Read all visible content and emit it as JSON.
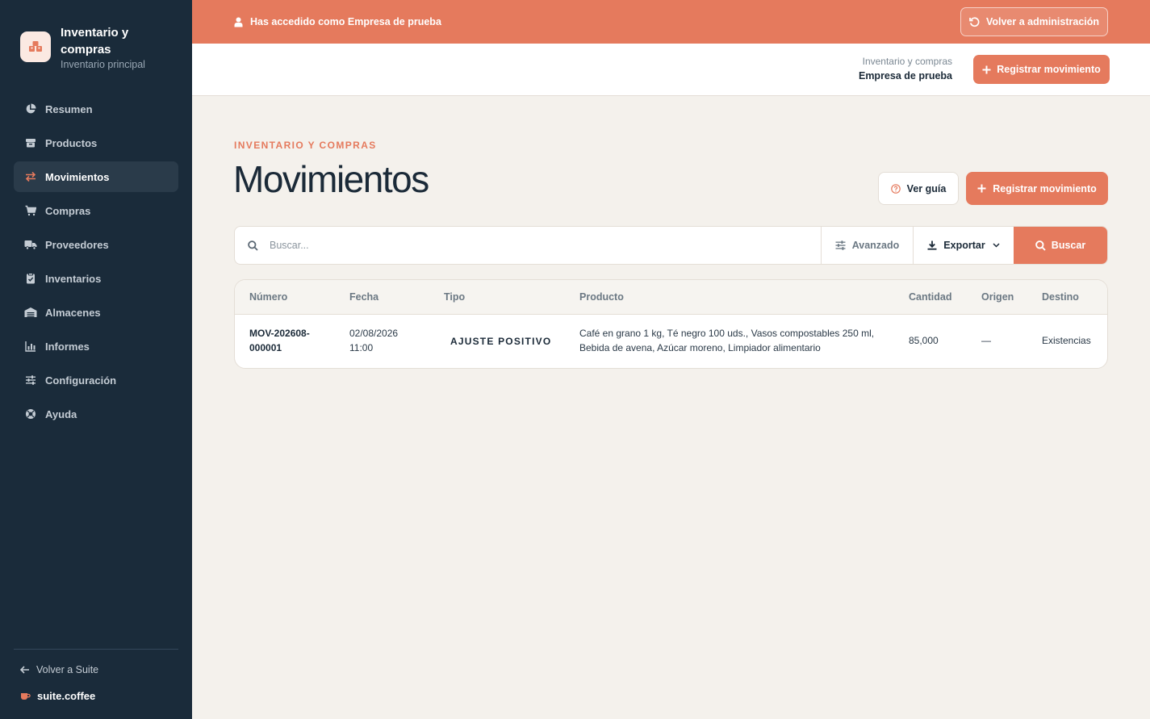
{
  "sidebar": {
    "app_title": "Inventario y compras",
    "app_subtitle": "Inventario principal",
    "items": [
      {
        "label": "Resumen",
        "icon": "pie-chart-icon"
      },
      {
        "label": "Productos",
        "icon": "box-icon"
      },
      {
        "label": "Movimientos",
        "icon": "arrows-swap-icon",
        "active": true
      },
      {
        "label": "Compras",
        "icon": "cart-icon"
      },
      {
        "label": "Proveedores",
        "icon": "truck-icon"
      },
      {
        "label": "Inventarios",
        "icon": "clipboard-check-icon"
      },
      {
        "label": "Almacenes",
        "icon": "warehouse-icon"
      },
      {
        "label": "Informes",
        "icon": "bar-chart-icon"
      },
      {
        "label": "Configuración",
        "icon": "sliders-icon"
      },
      {
        "label": "Ayuda",
        "icon": "lifebuoy-icon"
      }
    ],
    "back_label": "Volver a Suite",
    "suite_brand": "suite.coffee"
  },
  "banner": {
    "text": "Has accedido como Empresa de prueba",
    "button_label": "Volver a administración"
  },
  "header": {
    "crumb_module": "Inventario y compras",
    "crumb_company": "Empresa de prueba",
    "button_label": "Registrar movimiento"
  },
  "main": {
    "eyebrow": "INVENTARIO Y COMPRAS",
    "title": "Movimientos",
    "guide_label": "Ver guía",
    "primary_label": "Registrar movimiento"
  },
  "search": {
    "placeholder": "Buscar...",
    "value": "",
    "advanced_label": "Avanzado",
    "export_label": "Exportar",
    "submit_label": "Buscar"
  },
  "table": {
    "columns": [
      "Número",
      "Fecha",
      "Tipo",
      "Producto",
      "Cantidad",
      "Origen",
      "Destino"
    ],
    "rows": [
      {
        "numero_l1": "MOV-202608-",
        "numero_l2": "000001",
        "fecha_l1": "02/08/2026",
        "fecha_l2": "11:00",
        "tipo": "AJUSTE POSITIVO",
        "producto_l1": "Café en grano 1 kg, Té negro 100 uds., Vasos compostables 250 ml,",
        "producto_l2": "Bebida de avena, Azúcar moreno, Limpiador alimentario",
        "cantidad": "85,000",
        "origen": "—",
        "destino": "Existencias"
      }
    ]
  },
  "colors": {
    "accent": "#e57a5d",
    "sidebar_bg": "#1a2b3a",
    "page_bg": "#f4f1ec"
  }
}
